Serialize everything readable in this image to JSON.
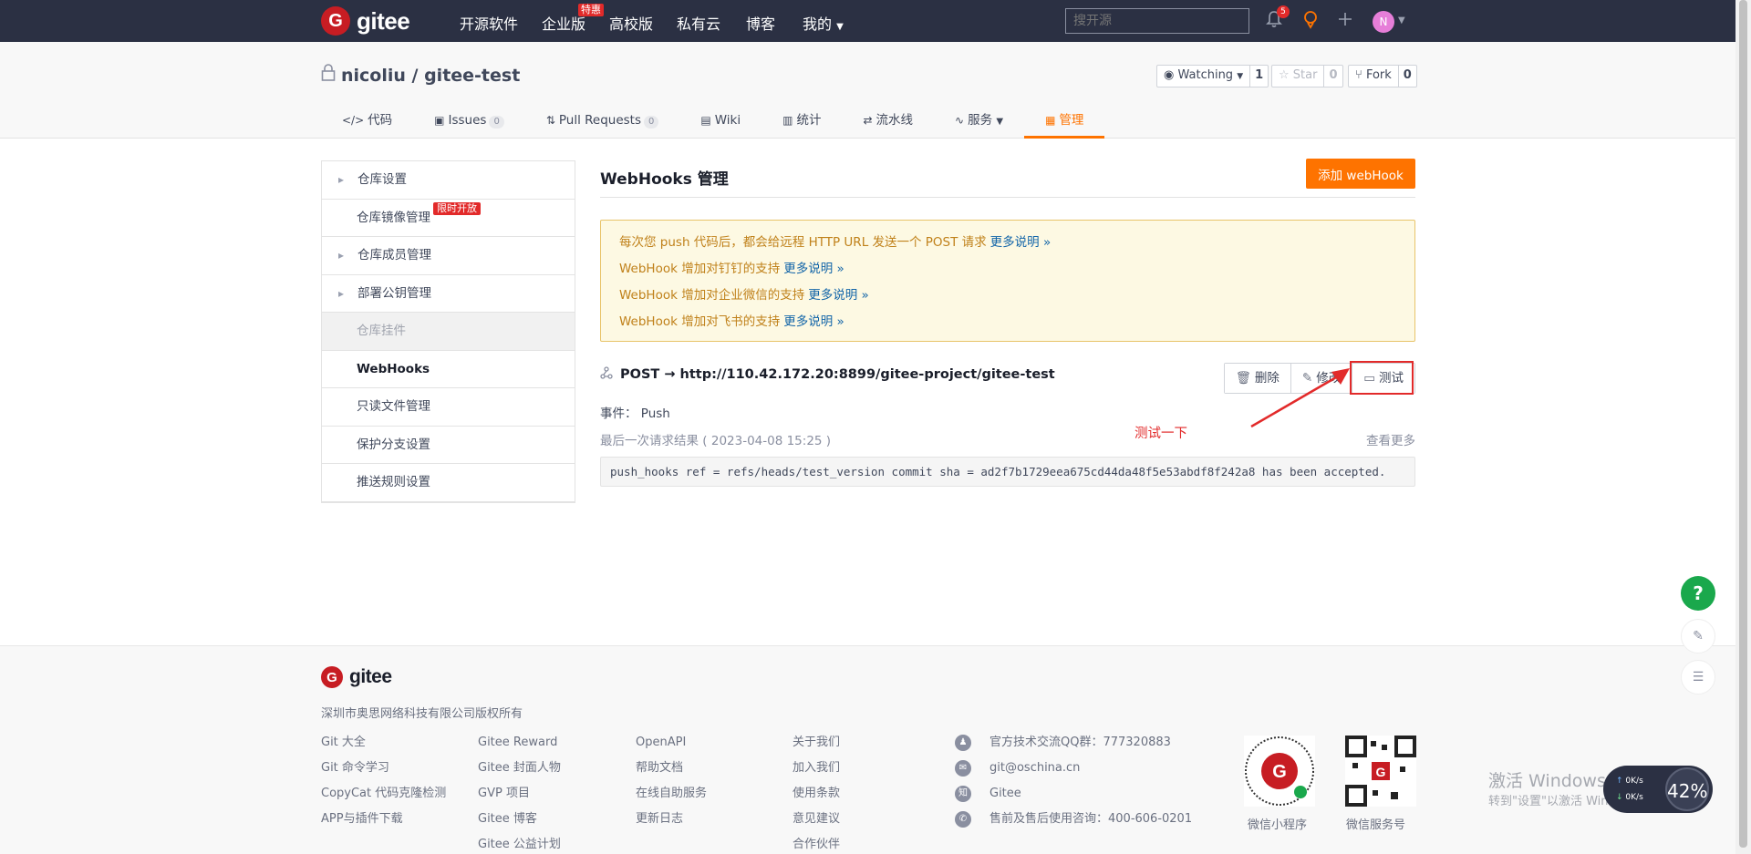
{
  "nav": {
    "brand": "gitee",
    "items": [
      "开源软件",
      "企业版",
      "高校版",
      "私有云",
      "博客",
      "我的"
    ],
    "enterprise_badge": "特惠",
    "search_placeholder": "搜开源",
    "notification_count": "5",
    "avatar_initial": "N"
  },
  "repo": {
    "title": "nicoliu / gitee-test",
    "watching_label": "Watching",
    "watching_count": "1",
    "star_label": "Star",
    "star_count": "0",
    "fork_label": "Fork",
    "fork_count": "0"
  },
  "tabs": [
    {
      "label": "代码"
    },
    {
      "label": "Issues",
      "count": "0"
    },
    {
      "label": "Pull Requests",
      "count": "0"
    },
    {
      "label": "Wiki"
    },
    {
      "label": "统计"
    },
    {
      "label": "流水线"
    },
    {
      "label": "服务"
    },
    {
      "label": "管理"
    }
  ],
  "sidebar": {
    "items": [
      {
        "label": "仓库设置"
      },
      {
        "label": "仓库镜像管理"
      },
      {
        "label": "仓库成员管理"
      },
      {
        "label": "部署公钥管理"
      },
      {
        "label": "仓库挂件"
      },
      {
        "label": "WebHooks"
      },
      {
        "label": "只读文件管理"
      },
      {
        "label": "保护分支设置"
      },
      {
        "label": "推送规则设置"
      }
    ],
    "mirror_badge": "限时开放"
  },
  "main": {
    "title": "WebHooks 管理",
    "add_button": "添加 webHook",
    "notices": [
      {
        "text": "每次您 push 代码后，都会给远程 HTTP URL 发送一个 POST 请求",
        "more": "更多说明 »"
      },
      {
        "text": "WebHook 增加对钉钉的支持",
        "more": "更多说明 »"
      },
      {
        "text": "WebHook 增加对企业微信的支持",
        "more": "更多说明 »"
      },
      {
        "text": "WebHook 增加对飞书的支持",
        "more": "更多说明 »"
      }
    ],
    "hook": {
      "url": "POST → http://110.42.172.20:8899/gitee-project/gitee-test",
      "delete_label": "删除",
      "edit_label": "修改",
      "test_label": "测试",
      "event": "事件： Push",
      "last_result": "最后一次请求结果 ( 2023-04-08 15:25 )",
      "view_more": "查看更多",
      "response": "push_hooks ref = refs/heads/test_version commit sha = ad2f7b1729eea675cd44da48f5e53abdf8f242a8 has been accepted."
    },
    "annotation": "测试一下"
  },
  "footer": {
    "brand": "gitee",
    "copyright": "深圳市奥思网络科技有限公司版权所有",
    "col1": [
      "Git 大全",
      "Git 命令学习",
      "CopyCat 代码克隆检测",
      "APP与插件下载"
    ],
    "col2": [
      "Gitee Reward",
      "Gitee 封面人物",
      "GVP 项目",
      "Gitee 博客",
      "Gitee 公益计划"
    ],
    "col3": [
      "OpenAPI",
      "帮助文档",
      "在线自助服务",
      "更新日志"
    ],
    "col4": [
      "关于我们",
      "加入我们",
      "使用条款",
      "意见建议",
      "合作伙伴"
    ],
    "contacts": [
      "官方技术交流QQ群：777320883",
      "git@oschina.cn",
      "Gitee",
      "售前及售后使用咨询：400-606-0201"
    ],
    "qr1_label": "微信小程序",
    "qr2_label": "微信服务号"
  },
  "overlay": {
    "watermark_line1": "激活 Windows",
    "watermark_line2": "转到\"设置\"以激活 Windows。",
    "net_up": "0K/s",
    "net_down": "0K/s",
    "cpu": "42%"
  },
  "colors": {
    "accent": "#fe7300",
    "nav_bg": "#2b3043",
    "brand_red": "#c71d23",
    "annotation_red": "#e22a2a"
  }
}
